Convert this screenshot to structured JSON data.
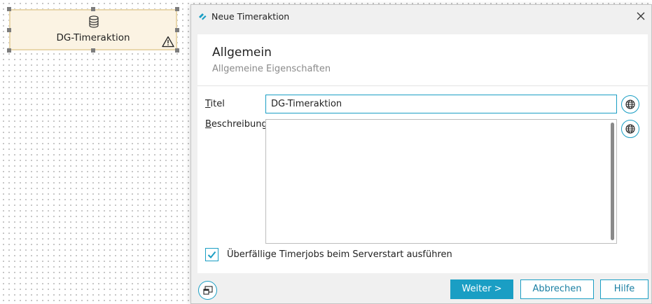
{
  "canvas": {
    "node": {
      "label": "DG-Timeraktion",
      "icon": "database-icon",
      "warning_icon": "warning-icon"
    }
  },
  "dialog": {
    "title": "Neue Timeraktion",
    "section": {
      "title": "Allgemein",
      "subtitle": "Allgemeine Eigenschaften"
    },
    "fields": {
      "title_label_mnemonic": "T",
      "title_label_rest": "itel",
      "title_value": "DG-Timeraktion",
      "description_label_mnemonic": "B",
      "description_label_rest": "eschreibung",
      "description_value": ""
    },
    "checkbox": {
      "label": "Überfällige Timerjobs beim Serverstart ausführen",
      "checked": true
    },
    "buttons": {
      "next": "Weiter >",
      "cancel": "Abbrechen",
      "help": "Hilfe"
    }
  },
  "colors": {
    "accent": "#1a9ec4",
    "node_fill": "#fbf3e3",
    "node_border": "#e9d7ac"
  }
}
